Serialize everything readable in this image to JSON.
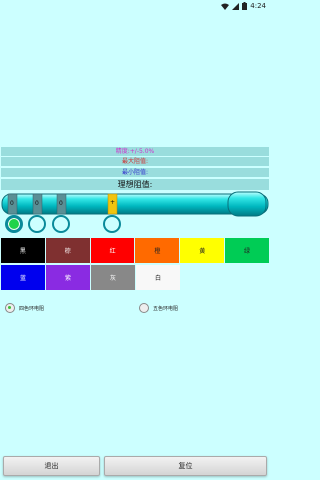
{
  "status": {
    "time": "4:24"
  },
  "info": {
    "precision": "精度:+/-5.0%",
    "max": "最大阻值:",
    "min": "最小阻值:",
    "ideal": "理想阻值:"
  },
  "colors": {
    "precision": "#cc33cc",
    "max": "#cc3333",
    "min": "#3333cc"
  },
  "bands": [
    {
      "label": "0"
    },
    {
      "label": "0"
    },
    {
      "label": "0"
    },
    {
      "label": "+"
    }
  ],
  "palette": [
    {
      "label": "黑",
      "bg": "#000000",
      "fg": "#ffffff"
    },
    {
      "label": "棕",
      "bg": "#7f3030",
      "fg": "#ffffff"
    },
    {
      "label": "红",
      "bg": "#ff0000",
      "fg": "#ffffff"
    },
    {
      "label": "橙",
      "bg": "#ff6a00",
      "fg": "#222222"
    },
    {
      "label": "黄",
      "bg": "#ffff00",
      "fg": "#222222"
    },
    {
      "label": "绿",
      "bg": "#00cc55",
      "fg": "#222222"
    },
    {
      "label": "蓝",
      "bg": "#0000ee",
      "fg": "#ffffff"
    },
    {
      "label": "紫",
      "bg": "#8a2be2",
      "fg": "#ffffff"
    },
    {
      "label": "灰",
      "bg": "#888888",
      "fg": "#ffffff"
    },
    {
      "label": "白",
      "bg": "#f8f8f8",
      "fg": "#222222"
    }
  ],
  "radios": {
    "four_band": "四色环电阻",
    "five_band": "五色环电阻"
  },
  "buttons": {
    "exit": "退出",
    "reset": "复位"
  }
}
